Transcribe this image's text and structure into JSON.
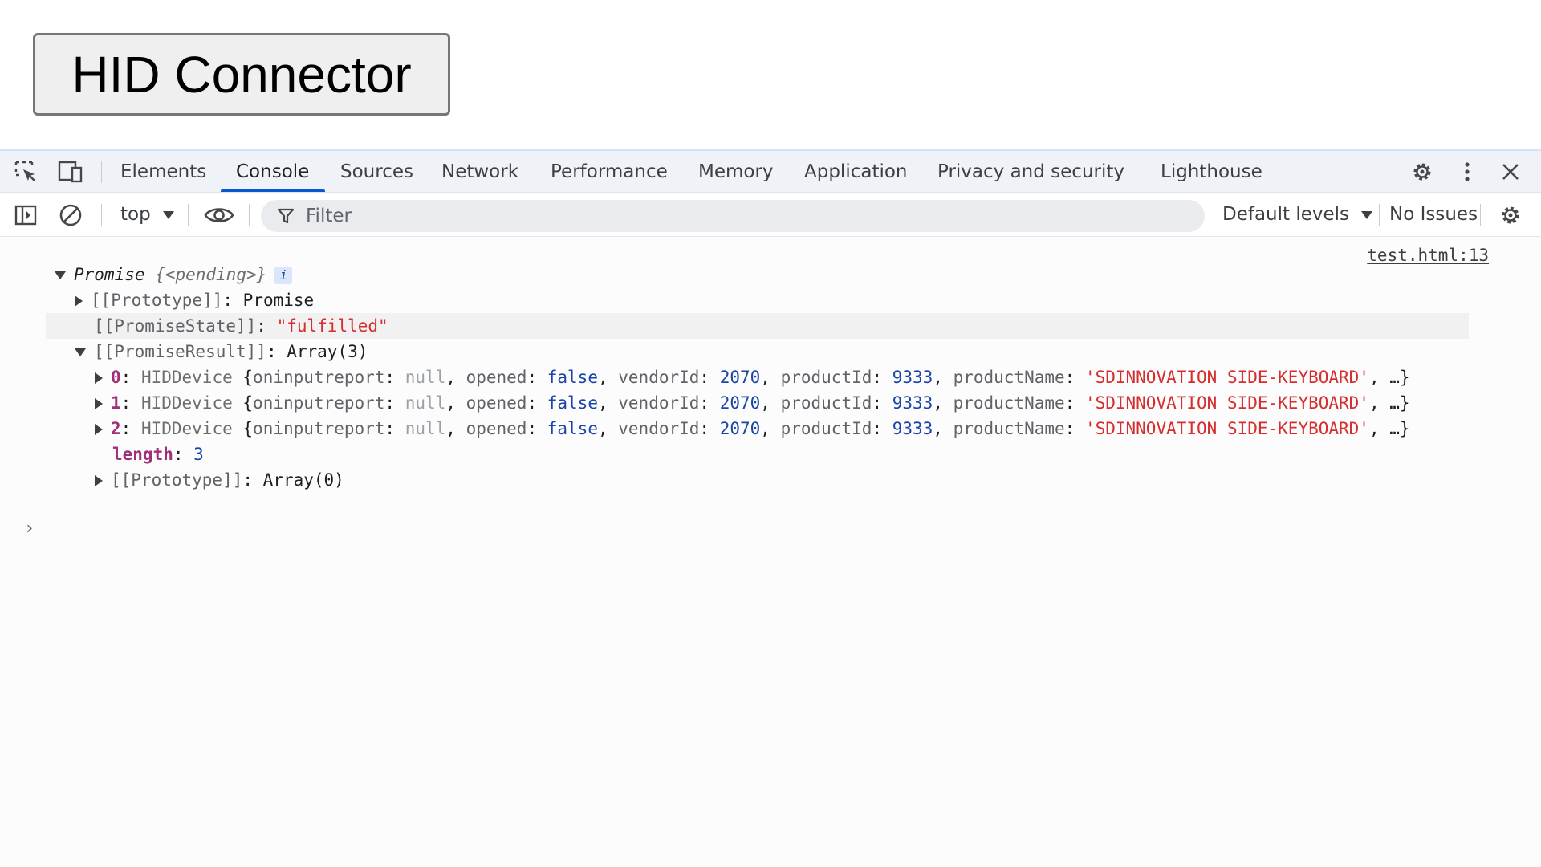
{
  "page": {
    "button_label": "HID Connector"
  },
  "devtools": {
    "tabs": [
      "Elements",
      "Console",
      "Sources",
      "Network",
      "Performance",
      "Memory",
      "Application",
      "Privacy and security",
      "Lighthouse"
    ],
    "active_tab": "Console",
    "toolbar": {
      "context": "top",
      "filter_placeholder": "Filter",
      "levels": "Default levels",
      "issues": "No Issues"
    }
  },
  "console": {
    "source_link": "test.html:13",
    "promise_label": "Promise",
    "promise_state_preview": "{<pending>}",
    "info_badge": "i",
    "prototype_key": "[[Prototype]]",
    "prototype_value": "Promise",
    "state_key": "[[PromiseState]]",
    "state_value": "\"fulfilled\"",
    "result_key": "[[PromiseResult]]",
    "result_value": "Array(3)",
    "devices": [
      {
        "index": "0",
        "type": "HIDDevice",
        "oninputreport": "null",
        "opened": "false",
        "vendorId": "2070",
        "productId": "9333",
        "productName": "'SDINNOVATION SIDE-KEYBOARD'"
      },
      {
        "index": "1",
        "type": "HIDDevice",
        "oninputreport": "null",
        "opened": "false",
        "vendorId": "2070",
        "productId": "9333",
        "productName": "'SDINNOVATION SIDE-KEYBOARD'"
      },
      {
        "index": "2",
        "type": "HIDDevice",
        "oninputreport": "null",
        "opened": "false",
        "vendorId": "2070",
        "productId": "9333",
        "productName": "'SDINNOVATION SIDE-KEYBOARD'"
      }
    ],
    "length_key": "length",
    "length_value": "3",
    "array_prototype_key": "[[Prototype]]",
    "array_prototype_value": "Array(0)",
    "prompt": "›"
  }
}
